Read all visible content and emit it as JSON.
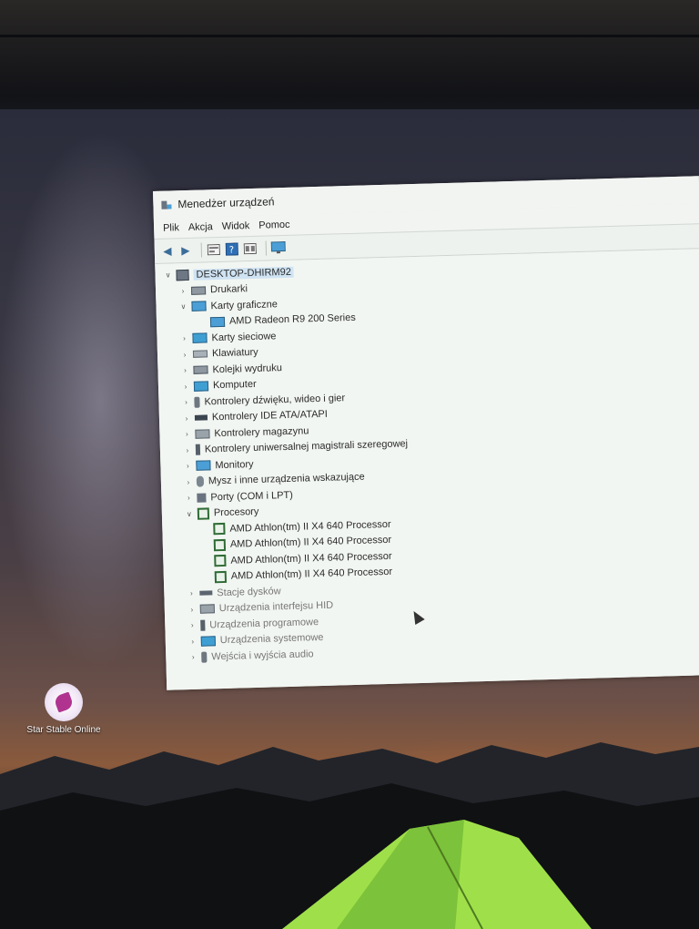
{
  "window": {
    "title": "Menedżer urządzeń",
    "menu": [
      "Plik",
      "Akcja",
      "Widok",
      "Pomoc"
    ]
  },
  "toolbar_icons": [
    "back-arrow-icon",
    "forward-arrow-icon",
    "properties-icon",
    "help-icon",
    "view-icon",
    "monitor-scan-icon"
  ],
  "tree": {
    "root": "DESKTOP-DHIRM92",
    "items": [
      {
        "label": "Drukarki",
        "icon": "printer-icon",
        "indent": 1,
        "chevron": ">"
      },
      {
        "label": "Karty graficzne",
        "icon": "display-adapter-icon",
        "indent": 1,
        "chevron": "v"
      },
      {
        "label": "AMD Radeon R9 200 Series",
        "icon": "display-adapter-icon",
        "indent": 2,
        "chevron": ""
      },
      {
        "label": "Karty sieciowe",
        "icon": "network-adapter-icon",
        "indent": 1,
        "chevron": ">"
      },
      {
        "label": "Klawiatury",
        "icon": "keyboard-icon",
        "indent": 1,
        "chevron": ">"
      },
      {
        "label": "Kolejki wydruku",
        "icon": "print-queue-icon",
        "indent": 1,
        "chevron": ">"
      },
      {
        "label": "Komputer",
        "icon": "computer-icon",
        "indent": 1,
        "chevron": ">"
      },
      {
        "label": "Kontrolery dźwięku, wideo i gier",
        "icon": "audio-icon",
        "indent": 1,
        "chevron": ">"
      },
      {
        "label": "Kontrolery IDE ATA/ATAPI",
        "icon": "ide-controller-icon",
        "indent": 1,
        "chevron": ">"
      },
      {
        "label": "Kontrolery magazynu",
        "icon": "storage-controller-icon",
        "indent": 1,
        "chevron": ">"
      },
      {
        "label": "Kontrolery uniwersalnej magistrali szeregowej",
        "icon": "usb-icon",
        "indent": 1,
        "chevron": ">"
      },
      {
        "label": "Monitory",
        "icon": "monitor-icon",
        "indent": 1,
        "chevron": ">"
      },
      {
        "label": "Mysz i inne urządzenia wskazujące",
        "icon": "mouse-icon",
        "indent": 1,
        "chevron": ">"
      },
      {
        "label": "Porty (COM i LPT)",
        "icon": "port-icon",
        "indent": 1,
        "chevron": ">"
      },
      {
        "label": "Procesory",
        "icon": "processor-icon",
        "indent": 1,
        "chevron": "v"
      },
      {
        "label": "AMD Athlon(tm) II X4 640 Processor",
        "icon": "processor-icon",
        "indent": 2,
        "chevron": ""
      },
      {
        "label": "AMD Athlon(tm) II X4 640 Processor",
        "icon": "processor-icon",
        "indent": 2,
        "chevron": ""
      },
      {
        "label": "AMD Athlon(tm) II X4 640 Processor",
        "icon": "processor-icon",
        "indent": 2,
        "chevron": ""
      },
      {
        "label": "AMD Athlon(tm) II X4 640 Processor",
        "icon": "processor-icon",
        "indent": 2,
        "chevron": ""
      },
      {
        "label": "Stacje dysków",
        "icon": "disk-drive-icon",
        "indent": 1,
        "chevron": ">"
      },
      {
        "label": "Urządzenia interfejsu HID",
        "icon": "hid-icon",
        "indent": 1,
        "chevron": ">"
      },
      {
        "label": "Urządzenia programowe",
        "icon": "software-device-icon",
        "indent": 1,
        "chevron": ">"
      },
      {
        "label": "Urządzenia systemowe",
        "icon": "system-device-icon",
        "indent": 1,
        "chevron": ">"
      },
      {
        "label": "Wejścia i wyjścia audio",
        "icon": "audio-io-icon",
        "indent": 1,
        "chevron": ">"
      }
    ]
  },
  "desktop": {
    "icon_label": "Star Stable Online"
  }
}
